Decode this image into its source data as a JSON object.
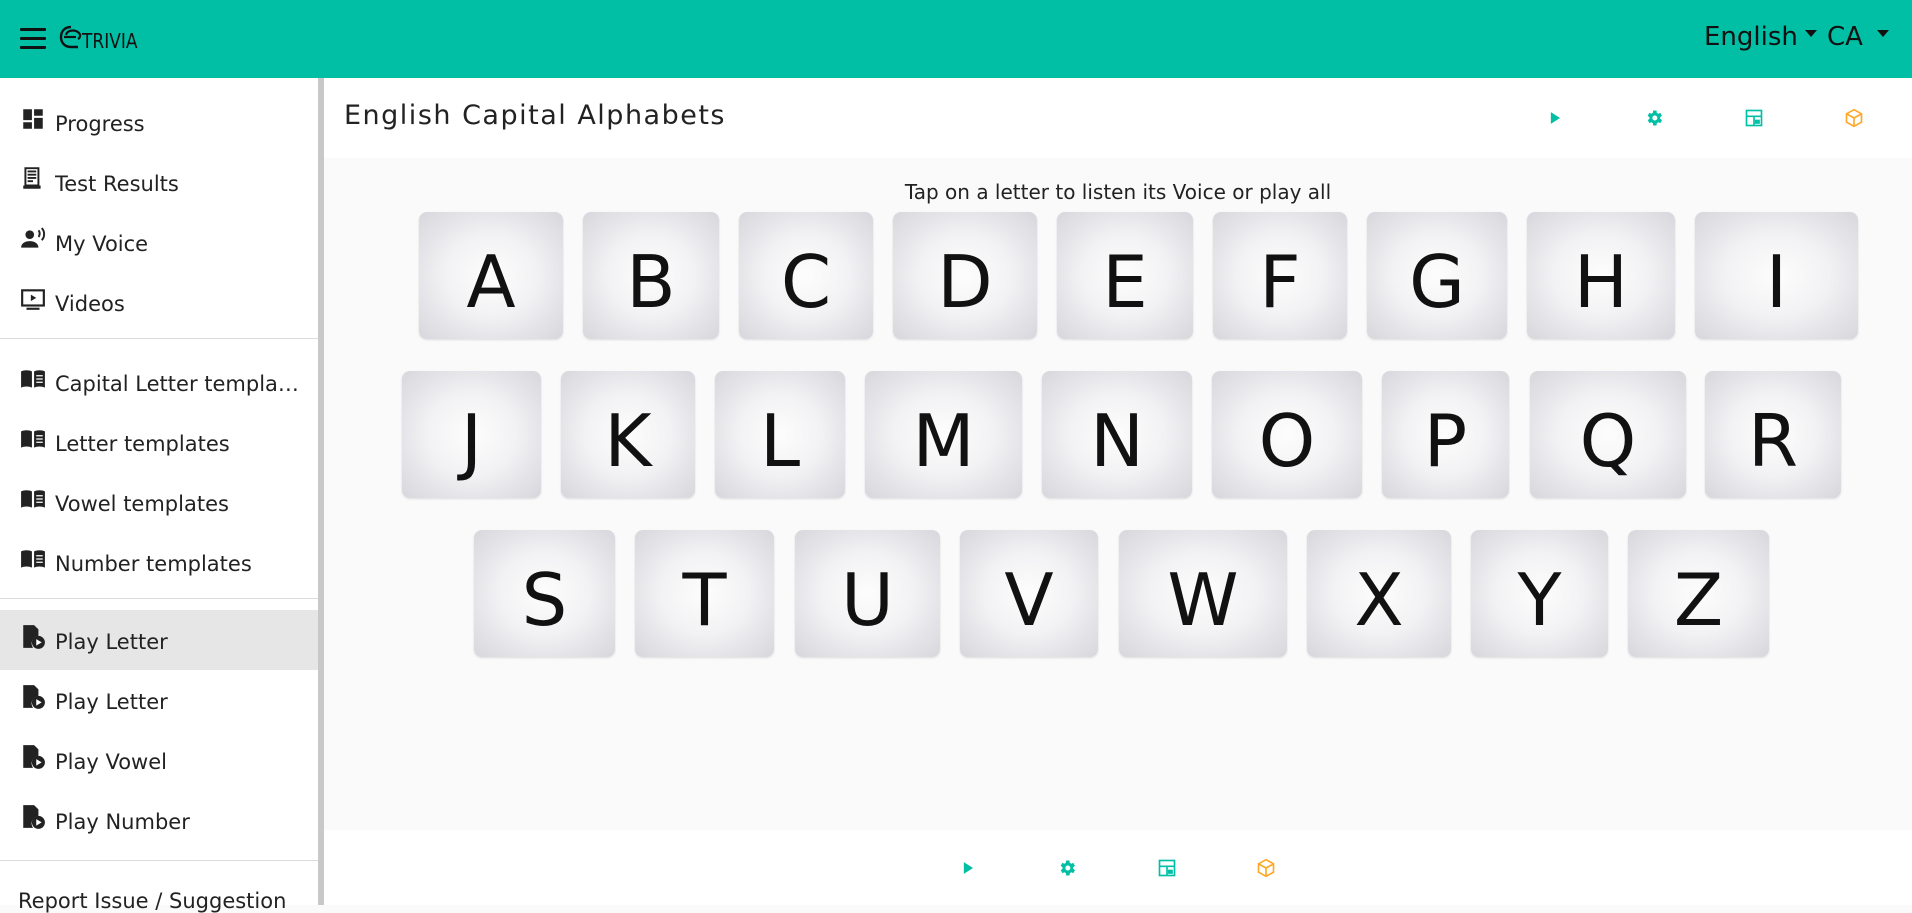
{
  "app": {
    "logo_text": "TRIVIA",
    "language": "English",
    "region": "CA",
    "accent_color": "#00bfa5",
    "orange_color": "#ffa726"
  },
  "sidebar": {
    "group1": [
      {
        "label": "Progress",
        "icon": "dashboard-icon"
      },
      {
        "label": "Test Results",
        "icon": "receipt-icon"
      },
      {
        "label": "My Voice",
        "icon": "voice-person-icon"
      },
      {
        "label": "Videos",
        "icon": "video-icon"
      }
    ],
    "group2": [
      {
        "label": "Capital Letter templates",
        "icon": "book-icon"
      },
      {
        "label": "Letter templates",
        "icon": "book-icon"
      },
      {
        "label": "Vowel templates",
        "icon": "book-icon"
      },
      {
        "label": "Number templates",
        "icon": "book-icon"
      }
    ],
    "group3": [
      {
        "label": "Play Letter",
        "icon": "play-file-icon",
        "active": true
      },
      {
        "label": "Play Letter",
        "icon": "play-file-icon"
      },
      {
        "label": "Play Vowel",
        "icon": "play-file-icon"
      },
      {
        "label": "Play Number",
        "icon": "play-file-icon"
      }
    ],
    "report_label": "Report Issue / Suggestion"
  },
  "main": {
    "title": "English Capital Alphabets",
    "instruction": "Tap on a letter to listen its Voice or play all",
    "toolbar_icons": [
      "play-icon",
      "gear-icon",
      "layout-icon",
      "cube-icon"
    ],
    "rows": [
      [
        "A",
        "B",
        "C",
        "D",
        "E",
        "F",
        "G",
        "H",
        "I"
      ],
      [
        "J",
        "K",
        "L",
        "M",
        "N",
        "O",
        "P",
        "Q",
        "R"
      ],
      [
        "S",
        "T",
        "U",
        "V",
        "W",
        "X",
        "Y",
        "Z"
      ]
    ]
  }
}
